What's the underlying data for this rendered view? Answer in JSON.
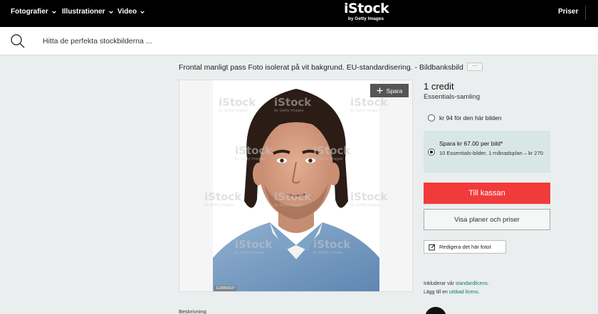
{
  "nav": {
    "items": [
      {
        "label": "Fotografier"
      },
      {
        "label": "Illustrationer"
      },
      {
        "label": "Video"
      }
    ],
    "logo_main": "iStock",
    "logo_sub": "by Getty Images",
    "pricing": "Priser"
  },
  "search": {
    "placeholder": "Hitta de perfekta stockbilderna ..."
  },
  "image": {
    "title": "Frontal manligt pass Foto isolerat på vit bakgrund. EU-standardisering. - Bildbanksbild",
    "more_label": "···",
    "save_label": "Spara",
    "watermark": "iStock",
    "watermark_sub": "by Getty Images",
    "stock_id": "1138955537"
  },
  "purchase": {
    "credit": "1 credit",
    "collection": "Essentials-samling",
    "option1_label": "kr 94 för den här bilden",
    "option2_title": "Spara kr 67.00 per bild*",
    "option2_desc": "10 Essentials-bilder, 1-månadsplan – kr 270",
    "checkout_label": "Till kassan",
    "plans_label": "Visa planer och priser",
    "edit_label": "Redigera det här fotot"
  },
  "license": {
    "line1_prefix": "Inkluderar vår ",
    "line1_link": "standardlicens",
    "line1_suffix": ".",
    "line2_prefix": "Lägg till en ",
    "line2_link": "utökad licens",
    "line2_suffix": "."
  },
  "description": {
    "label": "Beskrivning"
  },
  "colors": {
    "checkout": "#f13b3b",
    "selected_plan_bg": "#d9e6e6",
    "link": "#0a7a6e"
  }
}
